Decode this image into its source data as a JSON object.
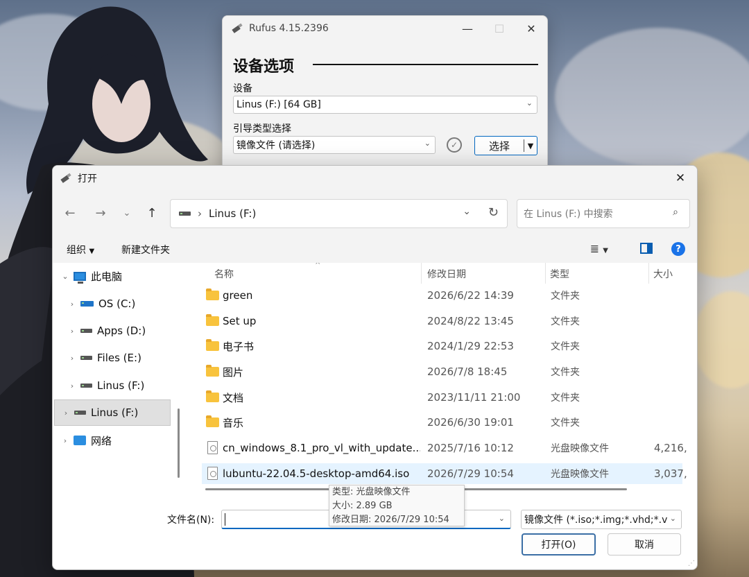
{
  "rufus": {
    "title": "Rufus 4.15.2396",
    "section_title": "设备选项",
    "device_label": "设备",
    "device_value": "Linus (F:) [64 GB]",
    "boot_label": "引导类型选择",
    "boot_value": "镜像文件 (请选择)",
    "select_label": "选择"
  },
  "dialog": {
    "title": "打开",
    "address": "Linus (F:)",
    "search_placeholder": "在 Linus (F:) 中搜索",
    "cmd_organize": "组织",
    "cmd_new_folder": "新建文件夹",
    "columns": {
      "name": "名称",
      "date": "修改日期",
      "type": "类型",
      "size": "大小"
    },
    "tree": [
      {
        "label": "此电脑",
        "twisty": "⌄",
        "kind": "pc"
      },
      {
        "label": "OS (C:)",
        "twisty": "›",
        "kind": "os"
      },
      {
        "label": "Apps (D:)",
        "twisty": "›",
        "kind": "drive"
      },
      {
        "label": "Files (E:)",
        "twisty": "›",
        "kind": "drive"
      },
      {
        "label": "Linus (F:)",
        "twisty": "›",
        "kind": "drive"
      },
      {
        "label": "Linus (F:)",
        "twisty": "›",
        "kind": "drive"
      },
      {
        "label": "网络",
        "twisty": "›",
        "kind": "network"
      }
    ],
    "files": [
      {
        "name": "green",
        "date": "2026/6/22 14:39",
        "type": "文件夹",
        "size": "",
        "kind": "folder"
      },
      {
        "name": "Set up",
        "date": "2024/8/22 13:45",
        "type": "文件夹",
        "size": "",
        "kind": "folder"
      },
      {
        "name": "电子书",
        "date": "2024/1/29 22:53",
        "type": "文件夹",
        "size": "",
        "kind": "folder"
      },
      {
        "name": "图片",
        "date": "2026/7/8 18:45",
        "type": "文件夹",
        "size": "",
        "kind": "folder"
      },
      {
        "name": "文档",
        "date": "2023/11/11 21:00",
        "type": "文件夹",
        "size": "",
        "kind": "folder"
      },
      {
        "name": "音乐",
        "date": "2026/6/30 19:01",
        "type": "文件夹",
        "size": "",
        "kind": "folder"
      },
      {
        "name": "cn_windows_8.1_pro_vl_with_update...",
        "date": "2025/7/16 10:12",
        "type": "光盘映像文件",
        "size": "4,216,",
        "kind": "iso"
      },
      {
        "name": "lubuntu-22.04.5-desktop-amd64.iso",
        "date": "2026/7/29 10:54",
        "type": "光盘映像文件",
        "size": "3,037,",
        "kind": "iso"
      }
    ],
    "tooltip": {
      "type": "类型: 光盘映像文件",
      "size": "大小: 2.89 GB",
      "date": "修改日期: 2026/7/29 10:54"
    },
    "filename_label": "文件名(N):",
    "filename_value": "",
    "filter_value": "镜像文件 (*.iso;*.img;*.vhd;*.v",
    "open_button": "打开(O)",
    "cancel_button": "取消"
  },
  "colors": {
    "accent": "#0067c0",
    "folder": "#f8c33d",
    "selection": "#e5f3ff"
  }
}
